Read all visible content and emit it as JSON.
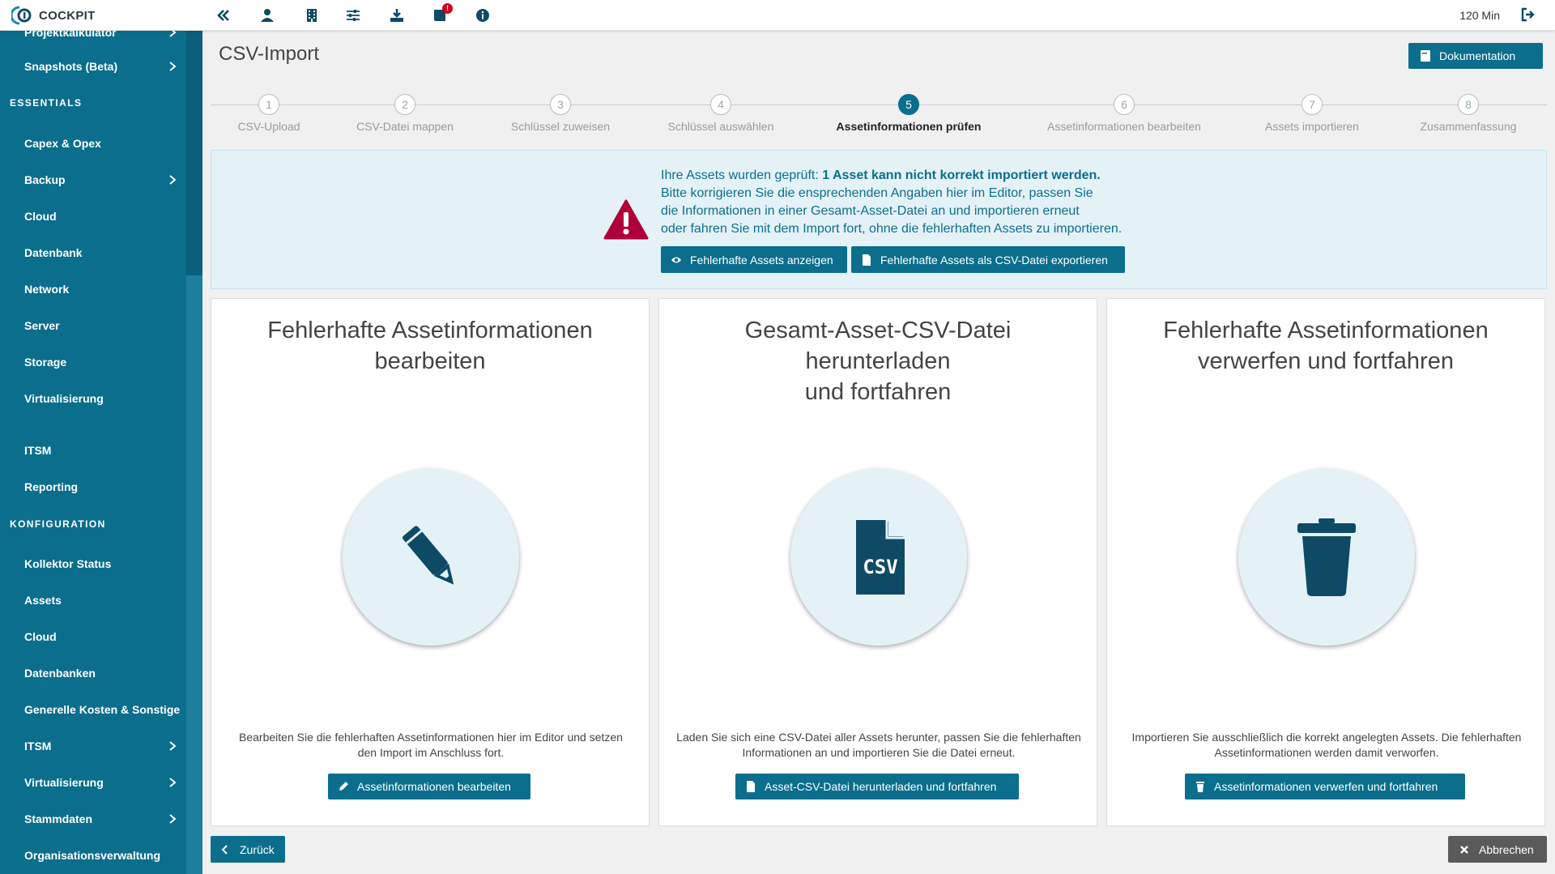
{
  "app": {
    "name": "COCKPIT",
    "timer": "120 Min",
    "notification_count": "!"
  },
  "sidebar": {
    "top_items": [
      {
        "label": "Projektkalkulator",
        "has_submenu": true
      },
      {
        "label": "Snapshots (Beta)",
        "has_submenu": true
      }
    ],
    "section_essentials": "ESSENTIALS",
    "essentials": [
      {
        "label": "Capex & Opex",
        "has_submenu": false
      },
      {
        "label": "Backup",
        "has_submenu": true
      },
      {
        "label": "Cloud",
        "has_submenu": false
      },
      {
        "label": "Datenbank",
        "has_submenu": false
      },
      {
        "label": "Network",
        "has_submenu": false
      },
      {
        "label": "Server",
        "has_submenu": false
      },
      {
        "label": "Storage",
        "has_submenu": false
      },
      {
        "label": "Virtualisierung",
        "has_submenu": false
      },
      {
        "label": "ITSM",
        "has_submenu": false
      },
      {
        "label": "Reporting",
        "has_submenu": false
      }
    ],
    "section_konfiguration": "KONFIGURATION",
    "konfiguration": [
      {
        "label": "Kollektor Status",
        "has_submenu": false
      },
      {
        "label": "Assets",
        "has_submenu": false
      },
      {
        "label": "Cloud",
        "has_submenu": false
      },
      {
        "label": "Datenbanken",
        "has_submenu": false
      },
      {
        "label": "Generelle Kosten & Sonstige",
        "has_submenu": false
      },
      {
        "label": "ITSM",
        "has_submenu": true
      },
      {
        "label": "Virtualisierung",
        "has_submenu": true
      },
      {
        "label": "Stammdaten",
        "has_submenu": true
      },
      {
        "label": "Organisationsverwaltung",
        "has_submenu": false
      }
    ]
  },
  "page": {
    "title": "CSV-Import",
    "doc_button": "Dokumentation"
  },
  "stepper": {
    "active": 5,
    "steps": [
      {
        "num": "1",
        "label": "CSV-Upload"
      },
      {
        "num": "2",
        "label": "CSV-Datei mappen"
      },
      {
        "num": "3",
        "label": "Schlüssel zuweisen"
      },
      {
        "num": "4",
        "label": "Schlüssel auswählen"
      },
      {
        "num": "5",
        "label": "Assetinformationen prüfen"
      },
      {
        "num": "6",
        "label": "Assetinformationen bearbeiten"
      },
      {
        "num": "7",
        "label": "Assets importieren"
      },
      {
        "num": "8",
        "label": "Zusammenfassung"
      }
    ]
  },
  "alert": {
    "line1_prefix": "Ihre Assets wurden geprüft: ",
    "line1_bold": "1 Asset kann nicht korrekt importiert werden.",
    "line2": "Bitte korrigieren Sie die ensprechenden Angaben hier im Editor, passen Sie",
    "line3": "die Informationen in einer Gesamt-Asset-Datei an und importieren erneut",
    "line4": "oder fahren Sie mit dem Import fort, ohne die fehlerhaften Assets zu importieren.",
    "show_button": "Fehlerhafte Assets anzeigen",
    "export_button": "Fehlerhafte Assets als CSV-Datei exportieren",
    "color": "#b0003a"
  },
  "cards": [
    {
      "title_line1": "Fehlerhafte Assetinformationen",
      "title_line2": "bearbeiten",
      "icon": "pencil-icon",
      "desc_line1": "Bearbeiten Sie die fehlerhaften Assetinformationen hier im Editor und setzen",
      "desc_line2": "den Import im Anschluss fort.",
      "button": "Assetinformationen bearbeiten"
    },
    {
      "title_line1": "Gesamt-Asset-CSV-Datei herunterladen",
      "title_line2": "und fortfahren",
      "icon": "csv-file-icon",
      "icon_text": "CSV",
      "desc_line1": "Laden Sie sich eine CSV-Datei aller Assets herunter, passen Sie die fehlerhaften",
      "desc_line2": "Informationen an und importieren Sie die Datei erneut.",
      "button": "Asset-CSV-Datei herunterladen und fortfahren"
    },
    {
      "title_line1": "Fehlerhafte Assetinformationen",
      "title_line2": "verwerfen und fortfahren",
      "icon": "trash-icon",
      "desc_line1": "Importieren Sie ausschließlich die korrekt angelegten Assets. Die fehlerhaften",
      "desc_line2": "Assetinformationen werden damit verworfen.",
      "button": "Assetinformationen verwerfen und fortfahren"
    }
  ],
  "footer": {
    "back_button": "Zurück",
    "cancel_button": "Abbrechen"
  },
  "colors": {
    "primary": "#0b6e8c",
    "sidebar": "#0b6e8c",
    "icon_dark": "#0e4a66",
    "alert_bg": "#e4f2f7",
    "cancel": "#5a5a5a"
  }
}
